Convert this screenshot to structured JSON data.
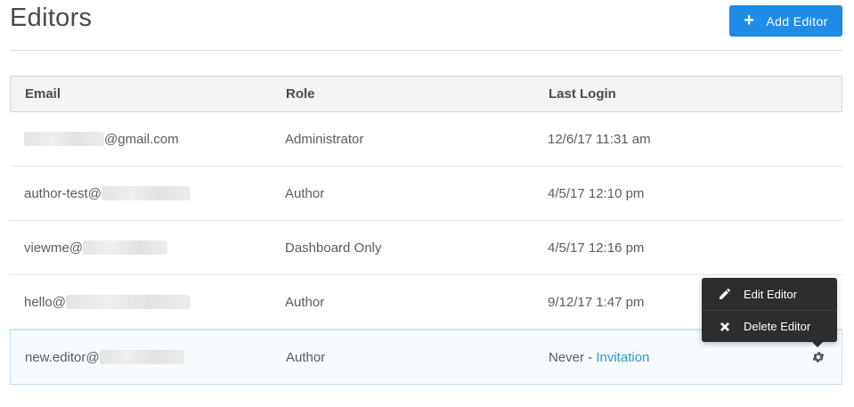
{
  "header": {
    "title": "Editors",
    "add_button": {
      "icon": "plus-icon",
      "label": "Add Editor"
    }
  },
  "table": {
    "columns": [
      "Email",
      "Role",
      "Last Login"
    ],
    "rows": [
      {
        "email_prefix": "",
        "email_suffix": "@gmail.com",
        "role": "Administrator",
        "last_login": "12/6/17 11:31 am"
      },
      {
        "email_prefix": "author-test@",
        "email_suffix": "",
        "role": "Author",
        "last_login": "4/5/17 12:10 pm"
      },
      {
        "email_prefix": "viewme@",
        "email_suffix": "",
        "role": "Dashboard Only",
        "last_login": "4/5/17 12:16 pm"
      },
      {
        "email_prefix": "hello@",
        "email_suffix": "",
        "role": "Author",
        "last_login": "9/12/17 1:47 pm"
      },
      {
        "email_prefix": "new.editor@",
        "email_suffix": "",
        "role": "Author",
        "last_login": "Never - ",
        "invitation_link": "Invitation"
      }
    ]
  },
  "context_menu": {
    "items": [
      {
        "icon": "pencil-icon",
        "label": "Edit Editor"
      },
      {
        "icon": "close-icon",
        "label": "Delete Editor"
      }
    ]
  },
  "colors": {
    "primary_button": "#1f8ce8",
    "link": "#2f9ad0",
    "menu_background": "#2b2d2e",
    "selected_row": "#f6fbfd"
  }
}
